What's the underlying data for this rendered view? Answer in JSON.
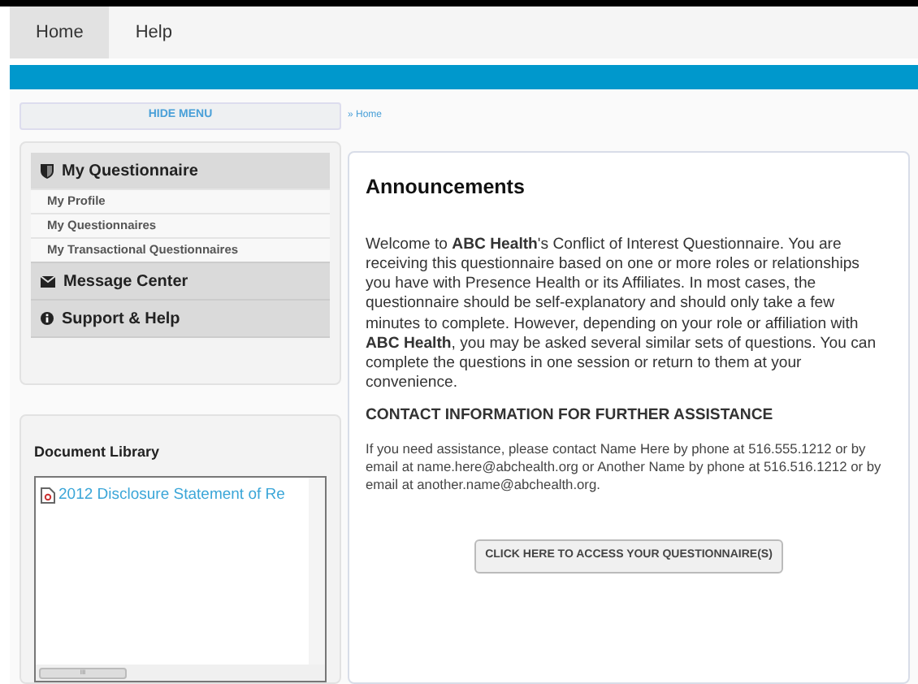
{
  "nav_tabs": [
    {
      "label": "Home",
      "selected": true
    },
    {
      "label": "Help",
      "selected": false
    }
  ],
  "hide_menu": "HIDE MENU",
  "breadcrumb": {
    "separator": "»",
    "link": "Home"
  },
  "menu": [
    {
      "label": "My Questionnaire",
      "kind": "shield",
      "children": [
        {
          "label": "My Profile"
        },
        {
          "label": "My Questionnaires"
        },
        {
          "label": "My Transactional Questionnaires"
        }
      ]
    },
    {
      "label": "Message Center",
      "kind": "envelope"
    },
    {
      "label": "Support & Help",
      "kind": "info"
    }
  ],
  "document_library": {
    "title": "Document Library",
    "documents": [
      "2012 Disclosure Statement of Re"
    ],
    "scroll_mark": "III"
  },
  "announcements": {
    "title": "Announcements",
    "intro": "Welcome to **ABC Health**'s Conflict of Interest Questionnaire. You are receiving this questionnaire based on one or more roles or relationships you have with Presence Health or its Affiliates. In most cases, the questionnaire should be self-explanatory and should only take a few minutes to complete. However, depending on your role or affiliation with **ABC Health**, you may be asked several similar sets of questions. You can complete the questions in one session or  return to them at your convenience.",
    "contact_heading": "CONTACT INFORMATION FOR FURTHER ASSISTANCE",
    "contact_text": "If you need assistance, please contact Name Here by phone at 516.555.1212 or by email at name.here@abchealth.org or Another Name by phone at 516.516.1212 or by email at another.name@abchealth.org.",
    "button": "CLICK HERE TO ACCESS YOUR QUESTIONNAIRE(S)"
  }
}
